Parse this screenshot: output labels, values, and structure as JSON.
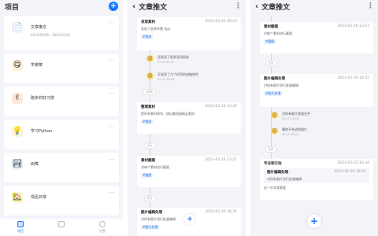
{
  "screen1": {
    "title": "项目",
    "projects": [
      {
        "name": "文章推文",
        "sub": "2023/02/05 - 2023/02/22"
      },
      {
        "name": "学做菜"
      },
      {
        "name": "跑步的好习惯"
      },
      {
        "name": "学习Python"
      },
      {
        "name": "树莓"
      },
      {
        "name": "情侣日常"
      }
    ],
    "tabs": [
      "项目",
      "",
      "设置"
    ]
  },
  "screen2": {
    "title": "文章推文",
    "notes": [
      {
        "title": "发现素材",
        "date": "2023-02-05 09:23",
        "body": "发现了很多牢靠 App",
        "tag": "#素材"
      },
      {
        "title": "整理素材",
        "date": "2023-02-15 10:20",
        "body": "把所有素材排列，挑出最质量精品素材",
        "tag": "#素材"
      },
      {
        "title": "素材截图",
        "date": "2023-02-18 13:27",
        "body": "对每个素材进行截图",
        "tag": "#截图"
      },
      {
        "title": "图片编辑处理",
        "date": "2023-02-20 18:31",
        "body": "对所有图片进行批量编辑",
        "tag": "#图片处理"
      }
    ],
    "comments": [
      {
        "text": "还发现了很多采用网站",
        "date": "02.05.09:30"
      },
      {
        "text": "又发现了几个好用的电脑软件",
        "date": "02.07.09:45"
      }
    ],
    "gaps": [
      "10天",
      "2天",
      "2天"
    ]
  },
  "screen3": {
    "title": "文章推文",
    "notes": [
      {
        "title": "素材截图",
        "date": "2023-02-18 13:27",
        "body": "对每个素材进行截图",
        "tag": "#截图"
      },
      {
        "title": "图片编辑处理",
        "date": "2023-02-20 18:31",
        "body": "对所有图片进行批量编辑",
        "tag": "#图片处理"
      },
      {
        "title": "专注和行动",
        "date": "2023-02-22 16:34",
        "body": "这一步非常重要"
      }
    ],
    "nested": {
      "title": "图片编辑处理",
      "date": "2023-02-20 18:31",
      "body": "对所有图片进行批量编辑"
    },
    "comments": [
      {
        "text": "对所有图片按组合并",
        "date": "02.21.15:18"
      },
      {
        "text": "删除不合适的图片",
        "date": "02.21.19:24"
      }
    ],
    "gaps": [
      "2天",
      "2天"
    ]
  }
}
